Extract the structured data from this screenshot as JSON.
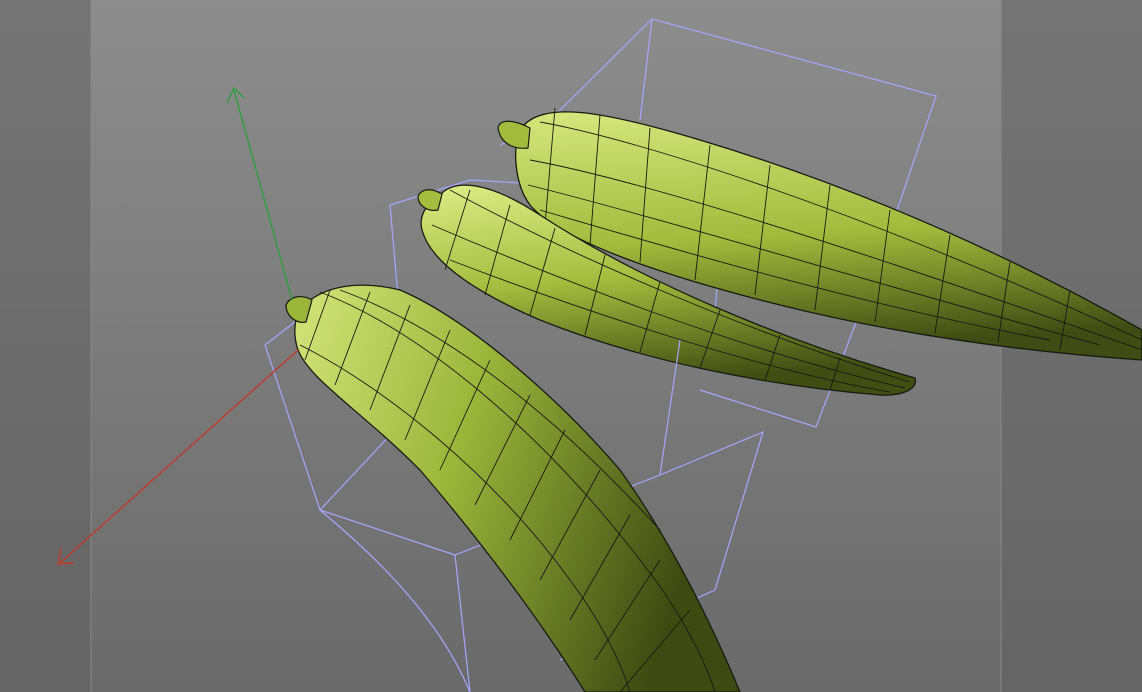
{
  "viewport": {
    "background_top": "#8d8d8d",
    "background_bottom": "#6a6a6a",
    "side_panel_color": "#616161",
    "safe_frame_color": "#888888"
  },
  "gizmo": {
    "x_axis_color": "#c0392b",
    "y_axis_color": "#2e9e3f"
  },
  "selection": {
    "bbox_color": "#a8a4ff"
  },
  "objects": [
    {
      "name": "okra-pod-front",
      "body_color": "#9bb53a",
      "highlight_color": "#d4e57a",
      "shadow_color": "#3d4a12"
    },
    {
      "name": "okra-pod-middle",
      "body_color": "#a5bd3e",
      "highlight_color": "#dcec86",
      "shadow_color": "#414e13"
    },
    {
      "name": "okra-pod-back",
      "body_color": "#a2bb3c",
      "highlight_color": "#d6e77e",
      "shadow_color": "#3f4c13"
    }
  ],
  "wireframe": {
    "color": "#1a1a10"
  }
}
